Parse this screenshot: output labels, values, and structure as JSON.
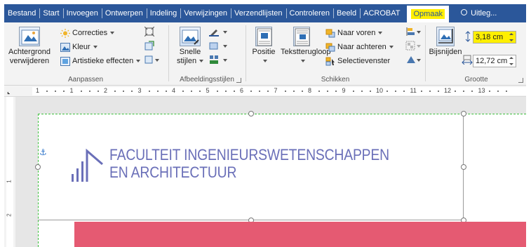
{
  "tabs": [
    {
      "label": "Bestand"
    },
    {
      "label": "Start"
    },
    {
      "label": "Invoegen"
    },
    {
      "label": "Ontwerpen"
    },
    {
      "label": "Indeling"
    },
    {
      "label": "Verwijzingen"
    },
    {
      "label": "Verzendlijsten"
    },
    {
      "label": "Controleren"
    },
    {
      "label": "Beeld"
    },
    {
      "label": "ACROBAT"
    }
  ],
  "active_tab": "Opmaak",
  "tell_me": "Uitleg...",
  "ribbon": {
    "remove_bg": {
      "line1": "Achtergrond",
      "line2": "verwijderen"
    },
    "corrections": "Correcties",
    "color": "Kleur",
    "artistic": "Artistieke effecten",
    "adjust_label": "Aanpassen",
    "quick_styles": {
      "line1": "Snelle",
      "line2": "stijlen"
    },
    "styles_label": "Afbeeldingsstijlen",
    "position": "Positie",
    "wrap_text": "Tekstterugloop",
    "bring_forward": "Naar voren",
    "send_backward": "Naar achteren",
    "selection_pane": "Selectievenster",
    "arrange_label": "Schikken",
    "crop": "Bijsnijden",
    "height_value": "3,18 cm",
    "width_value": "12,72 cm",
    "size_label": "Grootte"
  },
  "ruler": {
    "numbers": [
      "1",
      "1",
      "2",
      "3",
      "4",
      "5",
      "6",
      "7",
      "8",
      "9",
      "10",
      "11",
      "12",
      "13"
    ]
  },
  "vruler": {
    "numbers": [
      "1",
      "2"
    ]
  },
  "document": {
    "logo_line1": "FACULTEIT INGENIEURSWETENSCHAPPEN",
    "logo_line2": "EN ARCHITECTUUR"
  },
  "colors": {
    "ribbon_blue": "#2b579a",
    "highlight": "#ffef00",
    "logo_purple": "#6a6fb8",
    "banner_pink": "#e55a72"
  }
}
